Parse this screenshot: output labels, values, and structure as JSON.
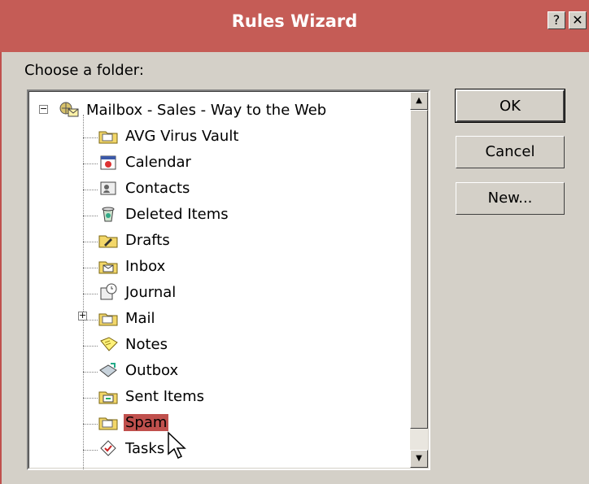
{
  "window": {
    "title": "Rules Wizard",
    "help_glyph": "?",
    "close_glyph": "✕"
  },
  "dialog": {
    "prompt": "Choose a folder:",
    "buttons": {
      "ok": "OK",
      "cancel": "Cancel",
      "new": "New..."
    }
  },
  "tree": {
    "root": {
      "label": "Mailbox - Sales - Way to the Web",
      "expander": "−",
      "icon": "mailbox-icon"
    },
    "items": [
      {
        "label": "AVG Virus Vault",
        "icon": "folder-icon"
      },
      {
        "label": "Calendar",
        "icon": "calendar-icon"
      },
      {
        "label": "Contacts",
        "icon": "contacts-icon"
      },
      {
        "label": "Deleted Items",
        "icon": "trash-icon"
      },
      {
        "label": "Drafts",
        "icon": "drafts-icon"
      },
      {
        "label": "Inbox",
        "icon": "inbox-icon"
      },
      {
        "label": "Journal",
        "icon": "journal-icon"
      },
      {
        "label": "Mail",
        "icon": "folder-icon",
        "expander": "+"
      },
      {
        "label": "Notes",
        "icon": "notes-icon"
      },
      {
        "label": "Outbox",
        "icon": "outbox-icon"
      },
      {
        "label": "Sent Items",
        "icon": "sent-items-icon"
      },
      {
        "label": "Spam",
        "icon": "folder-icon",
        "selected": true
      },
      {
        "label": "Tasks",
        "icon": "tasks-icon"
      }
    ]
  },
  "colors": {
    "title_bar": "#c55c56",
    "selection": "#c0504d",
    "face": "#d4d0c8"
  }
}
